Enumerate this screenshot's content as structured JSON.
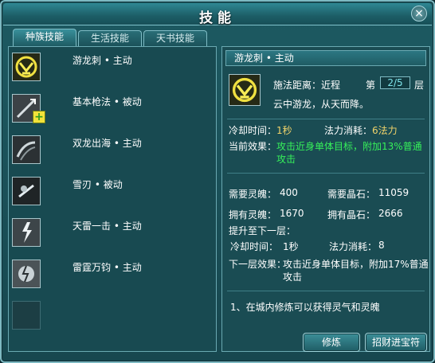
{
  "window": {
    "title": "技能",
    "close_label": "×"
  },
  "tabs": [
    {
      "label": "种族技能",
      "active": true
    },
    {
      "label": "生活技能",
      "active": false
    },
    {
      "label": "天书技能",
      "active": false
    }
  ],
  "skills": [
    {
      "name": "游龙刺 • 主动",
      "icon": "dragon-emblem-icon"
    },
    {
      "name": "基本枪法 • 被动",
      "icon": "spear-icon",
      "badge": "+"
    },
    {
      "name": "双龙出海 • 主动",
      "icon": "twin-dragon-icon"
    },
    {
      "name": "雪刃 • 被动",
      "icon": "snow-blade-icon"
    },
    {
      "name": "天雷一击 • 主动",
      "icon": "lightning-icon"
    },
    {
      "name": "雷霆万钧 • 主动",
      "icon": "thunder-icon"
    }
  ],
  "detail": {
    "header": "游龙刺 • 主动",
    "range_label": "施法距离：",
    "range_value": "近程",
    "layer_prefix": "第",
    "layer_value": "2/5",
    "layer_suffix": "层",
    "description": "云中游龙，从天而降。",
    "cooldown_label": "冷却时间：",
    "cooldown_value": "1秒",
    "mana_label": "法力消耗：",
    "mana_value": "6法力",
    "effect_label": "当前效果：",
    "effect_line1": "攻击近身单体目标，附加13%普通",
    "effect_line2": "攻击",
    "need_soul_label": "需要灵魄：",
    "need_soul_value": "400",
    "need_crystal_label": "需要晶石：",
    "need_crystal_value": "11059",
    "own_soul_label": "拥有灵魄：",
    "own_soul_value": "1670",
    "own_crystal_label": "拥有晶石：",
    "own_crystal_value": "2666",
    "next_title": "提升至下一层：",
    "next_cooldown_label": "冷却时间：",
    "next_cooldown_value": "1秒",
    "next_mana_label": "法力消耗：",
    "next_mana_value": "8",
    "next_effect_label": "下一层效果：",
    "next_effect_line1": "攻击近身单体目标，附加17%普通",
    "next_effect_line2": "攻击",
    "tip": "1、在城内修炼可以获得灵气和灵魄"
  },
  "buttons": {
    "train": "修炼",
    "fortune": "招财进宝符"
  },
  "colors": {
    "panel": "#1a4c53",
    "border": "#6aa9b2",
    "yellow_text": "#f1d36a",
    "green_text": "#36f05a"
  }
}
